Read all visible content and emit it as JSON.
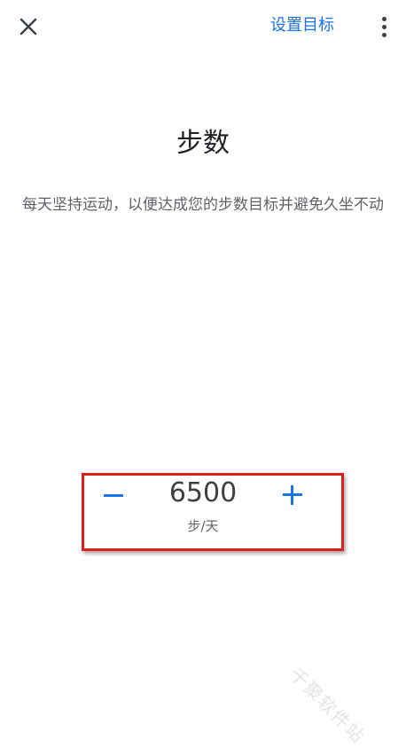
{
  "header": {
    "close_icon": "close-icon",
    "set_goal_label": "设置目标",
    "more_icon": "more-vert-icon"
  },
  "main": {
    "title": "步数",
    "description": "每天坚持运动，以便达成您的步数目标并避免久坐不动"
  },
  "stepper": {
    "value": "6500",
    "unit": "步/天",
    "decrement_icon": "minus-icon",
    "increment_icon": "plus-icon"
  },
  "colors": {
    "accent": "#1a73e8",
    "highlight": "#e21b1b",
    "text_primary": "#202124",
    "text_secondary": "#5f6368"
  },
  "watermark": "千聚软件站"
}
